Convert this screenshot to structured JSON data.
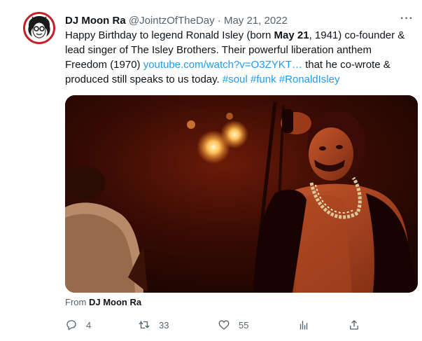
{
  "tweet": {
    "author_name": "DJ Moon Ra",
    "handle": "@JointzOfTheDay",
    "separator": "·",
    "date": "May 21, 2022",
    "more_label": "···",
    "text_1": "Happy Birthday to legend Ronald Isley (born ",
    "text_bold": "May 21",
    "text_2": ", 1941) co-founder & lead singer of The Isley Brothers. Their powerful liberation anthem Freedom (1970) ",
    "link": "youtube.com/watch?v=O3ZYKT…",
    "text_3": " that he co-wrote & produced still speaks to us today. ",
    "hashtags": [
      "#soul",
      "#funk",
      "#RonaldIsley"
    ],
    "from_prefix": "From",
    "from_name": "DJ Moon Ra"
  },
  "actions": {
    "reply_count": "4",
    "retweet_count": "33",
    "like_count": "55"
  },
  "icons": {
    "reply": "reply-icon",
    "retweet": "retweet-icon",
    "like": "heart-icon",
    "views": "views-icon",
    "share": "share-icon"
  },
  "colors": {
    "link": "#1d9bf0",
    "secondary_text": "#536471",
    "avatar_ring": "#c8202a"
  }
}
